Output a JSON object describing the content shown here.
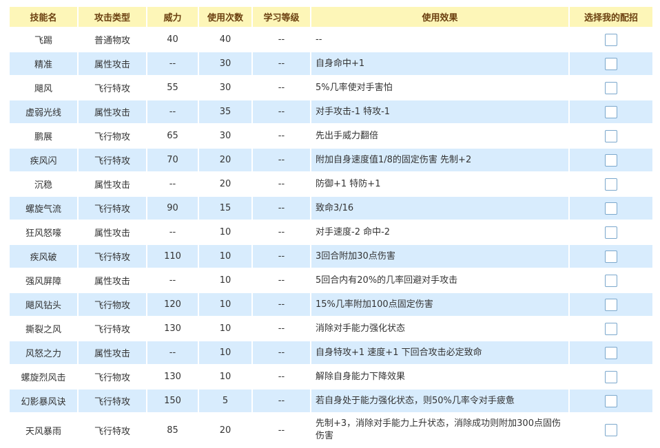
{
  "table": {
    "headers": [
      "技能名",
      "攻击类型",
      "威力",
      "使用次数",
      "学习等级",
      "使用效果",
      "选择我的配招"
    ],
    "rows": [
      {
        "name": "飞踢",
        "type": "普通物攻",
        "power": "40",
        "pp": "40",
        "level": "--",
        "effect": "--"
      },
      {
        "name": "精准",
        "type": "属性攻击",
        "power": "--",
        "pp": "30",
        "level": "--",
        "effect": "自身命中+1"
      },
      {
        "name": "飓风",
        "type": "飞行特攻",
        "power": "55",
        "pp": "30",
        "level": "--",
        "effect": "5%几率使对手害怕"
      },
      {
        "name": "虚弱光线",
        "type": "属性攻击",
        "power": "--",
        "pp": "35",
        "level": "--",
        "effect": "对手攻击-1 特攻-1"
      },
      {
        "name": "鹏展",
        "type": "飞行物攻",
        "power": "65",
        "pp": "30",
        "level": "--",
        "effect": "先出手威力翻倍"
      },
      {
        "name": "疾风闪",
        "type": "飞行特攻",
        "power": "70",
        "pp": "20",
        "level": "--",
        "effect": "附加自身速度值1/8的固定伤害 先制+2"
      },
      {
        "name": "沉稳",
        "type": "属性攻击",
        "power": "--",
        "pp": "20",
        "level": "--",
        "effect": "防御+1 特防+1"
      },
      {
        "name": "螺旋气流",
        "type": "飞行特攻",
        "power": "90",
        "pp": "15",
        "level": "--",
        "effect": "致命3/16"
      },
      {
        "name": "狂风怒嚎",
        "type": "属性攻击",
        "power": "--",
        "pp": "10",
        "level": "--",
        "effect": "对手速度-2 命中-2"
      },
      {
        "name": "疾风破",
        "type": "飞行特攻",
        "power": "110",
        "pp": "10",
        "level": "--",
        "effect": "3回合附加30点伤害"
      },
      {
        "name": "强风屏障",
        "type": "属性攻击",
        "power": "--",
        "pp": "10",
        "level": "--",
        "effect": "5回合内有20%的几率回避对手攻击"
      },
      {
        "name": "飓风钻头",
        "type": "飞行物攻",
        "power": "120",
        "pp": "10",
        "level": "--",
        "effect": "15%几率附加100点固定伤害"
      },
      {
        "name": "撕裂之风",
        "type": "飞行特攻",
        "power": "130",
        "pp": "10",
        "level": "--",
        "effect": "消除对手能力强化状态"
      },
      {
        "name": "风怒之力",
        "type": "属性攻击",
        "power": "--",
        "pp": "10",
        "level": "--",
        "effect": "自身特攻+1 速度+1 下回合攻击必定致命"
      },
      {
        "name": "螺旋烈风击",
        "type": "飞行物攻",
        "power": "130",
        "pp": "10",
        "level": "--",
        "effect": "解除自身能力下降效果"
      },
      {
        "name": "幻影暴风诀",
        "type": "飞行特攻",
        "power": "150",
        "pp": "5",
        "level": "--",
        "effect": "若自身处于能力强化状态，则50%几率令对手疲惫"
      },
      {
        "name": "天风暴雨",
        "type": "飞行特攻",
        "power": "85",
        "pp": "20",
        "level": "--",
        "effect": "先制+3，消除对手能力上升状态，消除成功则附加300点固伤伤害"
      }
    ]
  },
  "colors": {
    "header_bg": "#fdf6b8",
    "header_text": "#6b4010",
    "row_alt_bg": "#d8ecfd",
    "row_bg": "#ffffff",
    "checkbox_border": "#7aa7cc"
  },
  "icons": {
    "select": "checkbox-icon"
  }
}
